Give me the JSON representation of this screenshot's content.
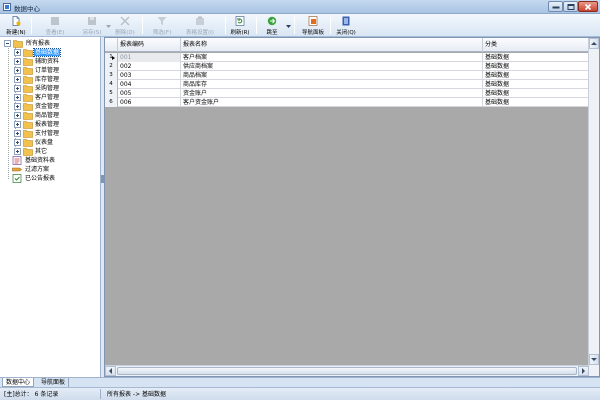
{
  "window": {
    "title": "数据中心"
  },
  "toolbar": {
    "buttons": [
      {
        "label": "新建(N)",
        "icon": "new-doc-icon",
        "enabled": true
      },
      {
        "label": "查看(E)",
        "icon": "view-icon",
        "enabled": false
      },
      {
        "label": "另存(S)",
        "icon": "save-as-icon",
        "enabled": false
      },
      {
        "label": "删除(D)",
        "icon": "delete-icon",
        "enabled": false
      },
      {
        "label": "筛选(F)",
        "icon": "filter-icon",
        "enabled": false
      },
      {
        "label": "表格设置(I)",
        "icon": "table-settings-icon",
        "enabled": false
      },
      {
        "label": "刷新(R)",
        "icon": "refresh-icon",
        "enabled": true
      },
      {
        "label": "跳至",
        "icon": "jump-icon",
        "enabled": true
      },
      {
        "label": "导航面板",
        "icon": "nav-panel-icon",
        "enabled": true
      },
      {
        "label": "关闭(Q)",
        "icon": "close-doc-icon",
        "enabled": true
      }
    ]
  },
  "tree": {
    "root": "所有报表",
    "children": [
      {
        "label": "基础数据",
        "selected": true
      },
      {
        "label": "辅助资料"
      },
      {
        "label": "订单管理"
      },
      {
        "label": "库存管理"
      },
      {
        "label": "采购管理"
      },
      {
        "label": "客户管理"
      },
      {
        "label": "资金管理"
      },
      {
        "label": "商品管理"
      },
      {
        "label": "报表管理"
      },
      {
        "label": "支付管理"
      },
      {
        "label": "仪表盘"
      },
      {
        "label": "其它"
      }
    ],
    "extra": [
      {
        "label": "基础资料表"
      },
      {
        "label": "过滤方案"
      },
      {
        "label": "已公告报表"
      }
    ]
  },
  "grid": {
    "columns": [
      "报表编码",
      "报表名称",
      "分类"
    ],
    "rows": [
      {
        "num": "1",
        "code": "001",
        "name": "客户档案",
        "category": "基础数据"
      },
      {
        "num": "2",
        "code": "002",
        "name": "供应商档案",
        "category": "基础数据"
      },
      {
        "num": "3",
        "code": "003",
        "name": "商品档案",
        "category": "基础数据"
      },
      {
        "num": "4",
        "code": "004",
        "name": "商品库存",
        "category": "基础数据"
      },
      {
        "num": "5",
        "code": "005",
        "name": "资金账户",
        "category": "基础数据"
      },
      {
        "num": "6",
        "code": "006",
        "name": "客户资金账户",
        "category": "基础数据"
      }
    ]
  },
  "tabs": [
    "数据中心",
    "导航面板"
  ],
  "status": {
    "records": "[主]总计： 6 条记录",
    "path": "所有报表 -> 基础数据"
  }
}
